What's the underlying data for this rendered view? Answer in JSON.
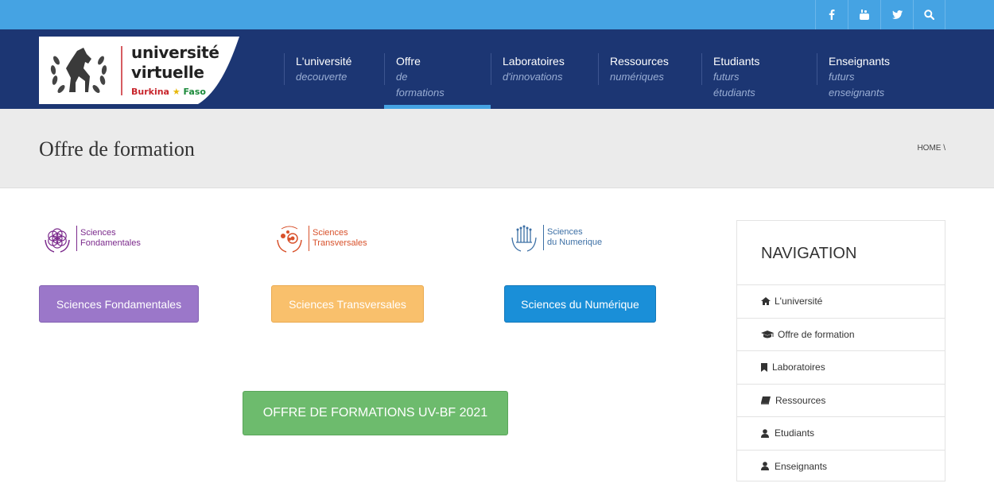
{
  "topbar": {
    "social": [
      {
        "icon": "facebook-icon",
        "glyph": "f"
      },
      {
        "icon": "youtube-icon",
        "glyph": "▶"
      },
      {
        "icon": "twitter-icon",
        "glyph": "🐦"
      },
      {
        "icon": "search-icon",
        "glyph": "⚲"
      }
    ]
  },
  "logo": {
    "line1": "université",
    "line2": "virtuelle",
    "burkina": "Burkina",
    "star": "★",
    "faso": "Faso"
  },
  "nav": [
    {
      "main": "L'université",
      "sub": "decouverte"
    },
    {
      "main": "Offre",
      "sub": "de formations"
    },
    {
      "main": "Laboratoires",
      "sub": "d'innovations"
    },
    {
      "main": "Ressources",
      "sub": "numériques"
    },
    {
      "main": "Etudiants",
      "sub": "futurs étudiants"
    },
    {
      "main": "Enseignants",
      "sub": "futurs enseignants"
    }
  ],
  "page": {
    "title": "Offre de formation",
    "breadcrumb": "HOME \\"
  },
  "sciences": [
    {
      "line1": "Sciences",
      "line2": "Fondamentales",
      "color": "#7b2a8c"
    },
    {
      "line1": "Sciences",
      "line2": "Transversales",
      "color": "#d8512b"
    },
    {
      "line1": "Sciences",
      "line2": "du Numerique",
      "color": "#3c6fa5"
    }
  ],
  "buttons": {
    "fondamentales": "Sciences Fondamentales",
    "transversales": "Sciences Transversales",
    "numerique": "Sciences du Numérique",
    "offre": "OFFRE DE FORMATIONS UV-BF 2021"
  },
  "sidebar": {
    "title": "NAVIGATION",
    "items": [
      {
        "label": "L'université",
        "icon": "home-icon"
      },
      {
        "label": "Offre de formation",
        "icon": "graduation-cap-icon"
      },
      {
        "label": "Laboratoires",
        "icon": "bookmark-icon"
      },
      {
        "label": "Ressources",
        "icon": "book-icon"
      },
      {
        "label": "Etudiants",
        "icon": "user-icon"
      },
      {
        "label": "Enseignants",
        "icon": "user-icon"
      }
    ]
  },
  "colors": {
    "topbar": "#45a3e3",
    "header": "#1c3673",
    "purple": "#9b77c9",
    "orange": "#f9c06c",
    "blue": "#1a8fd8",
    "green": "#6dbb6d"
  }
}
